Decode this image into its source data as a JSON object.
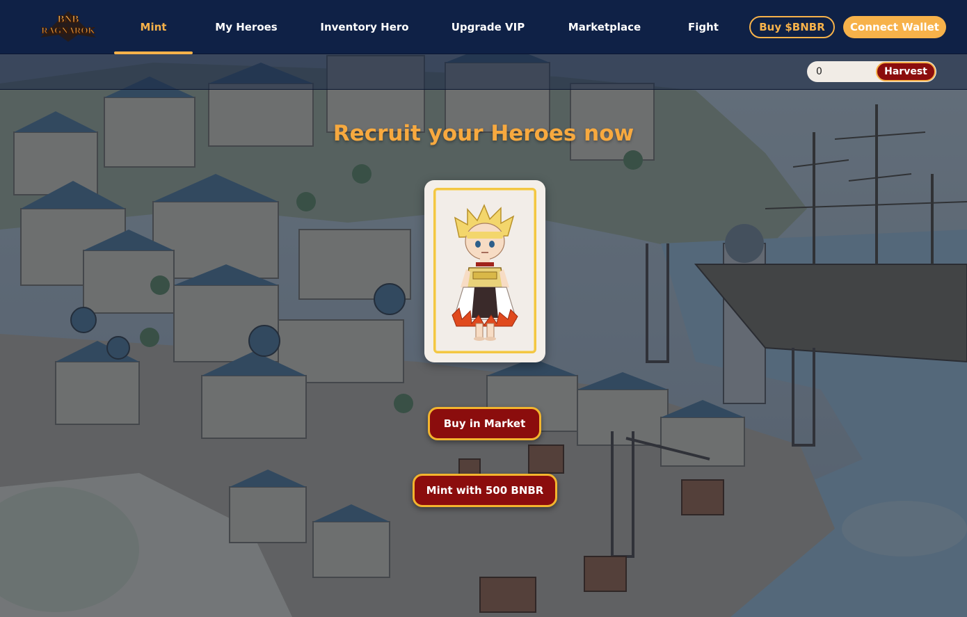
{
  "logo": {
    "text_line1": "BNB",
    "text_line2": "RAGNAROK"
  },
  "nav": {
    "items": [
      {
        "label": "Mint",
        "active": true
      },
      {
        "label": "My Heroes",
        "active": false
      },
      {
        "label": "Inventory Hero",
        "active": false
      },
      {
        "label": "Upgrade VIP",
        "active": false
      },
      {
        "label": "Marketplace",
        "active": false
      },
      {
        "label": "Fight",
        "active": false
      }
    ],
    "buy_label": "Buy $BNBR",
    "connect_label": "Connect Wallet"
  },
  "harvest": {
    "value": "0",
    "button_label": "Harvest"
  },
  "main": {
    "headline": "Recruit your Heroes now",
    "buy_market_label": "Buy in Market",
    "mint_label": "Mint with 500 BNBR"
  },
  "colors": {
    "nav_bg": "#0f2146",
    "accent": "#f7b24a",
    "headline": "#f7a93f",
    "button_red": "#8b0d0d",
    "button_border": "#f3b52e"
  },
  "icons": {
    "logo": "bnb-ragnarok-logo",
    "hero": "hero-character-sprite"
  }
}
